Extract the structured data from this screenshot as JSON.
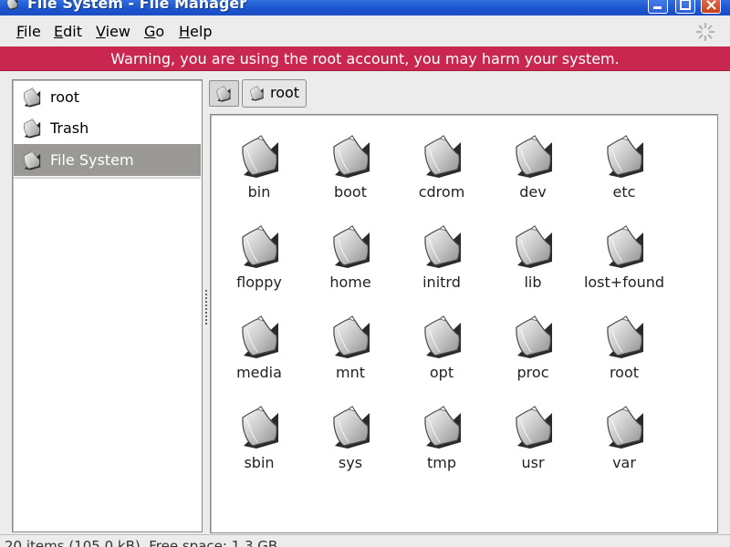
{
  "window": {
    "title": "File System - File Manager",
    "controls": [
      "minimize",
      "maximize",
      "close"
    ]
  },
  "menu": [
    {
      "mnemonic": "F",
      "rest": "ile"
    },
    {
      "mnemonic": "E",
      "rest": "dit"
    },
    {
      "mnemonic": "V",
      "rest": "iew"
    },
    {
      "mnemonic": "G",
      "rest": "o"
    },
    {
      "mnemonic": "H",
      "rest": "elp"
    }
  ],
  "warning": "Warning, you are using the root account, you may harm your system.",
  "places": [
    {
      "label": "root",
      "icon": "home-folder-icon",
      "selected": false
    },
    {
      "label": "Trash",
      "icon": "trash-icon",
      "selected": false
    },
    {
      "label": "File System",
      "icon": "drive-icon",
      "selected": true
    }
  ],
  "path": {
    "crumb": "root"
  },
  "folders": [
    "bin",
    "boot",
    "cdrom",
    "dev",
    "etc",
    "floppy",
    "home",
    "initrd",
    "lib",
    "lost+found",
    "media",
    "mnt",
    "opt",
    "proc",
    "root",
    "sbin",
    "sys",
    "tmp",
    "usr",
    "var"
  ],
  "status": "20 items (105.0 kB), Free space: 1.3 GB",
  "colors": {
    "titlebar": "#1c55d0",
    "warning": "#c9274f",
    "selection": "#9a9996"
  }
}
